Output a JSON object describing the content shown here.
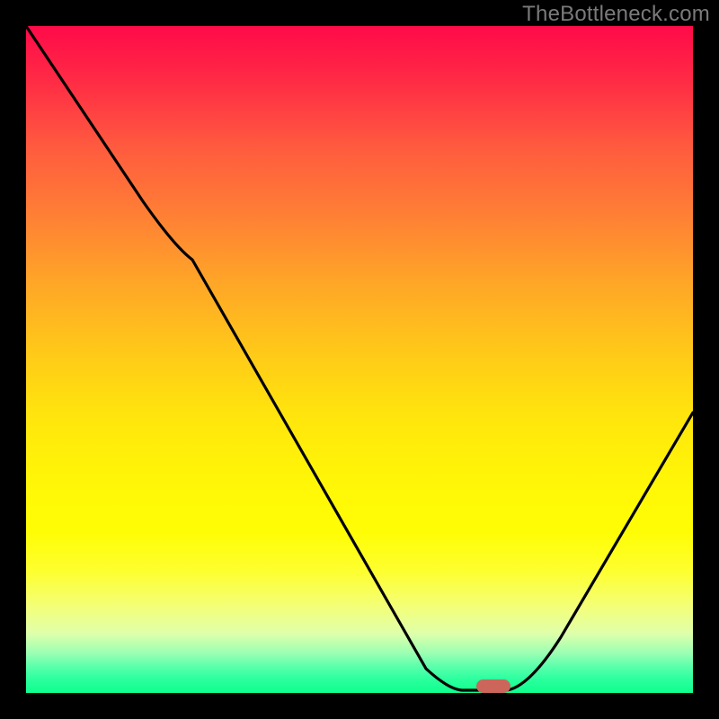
{
  "watermark": "TheBottleneck.com",
  "chart_data": {
    "type": "line",
    "title": "",
    "xlabel": "",
    "ylabel": "",
    "x_range": [
      0,
      100
    ],
    "y_range": [
      0,
      100
    ],
    "curve_points": [
      {
        "x": 0,
        "y": 100
      },
      {
        "x": 18,
        "y": 74
      },
      {
        "x": 25,
        "y": 66
      },
      {
        "x": 60,
        "y": 4
      },
      {
        "x": 65,
        "y": 0.5
      },
      {
        "x": 72,
        "y": 0.5
      },
      {
        "x": 80,
        "y": 8
      },
      {
        "x": 100,
        "y": 42
      }
    ],
    "marker": {
      "x": 70,
      "y": 0.5,
      "color": "#cc665b"
    },
    "gradient_stops": [
      {
        "pos": 0.0,
        "color": "#ff0a49"
      },
      {
        "pos": 0.5,
        "color": "#ffe40d"
      },
      {
        "pos": 1.0,
        "color": "#0eff8e"
      }
    ]
  }
}
